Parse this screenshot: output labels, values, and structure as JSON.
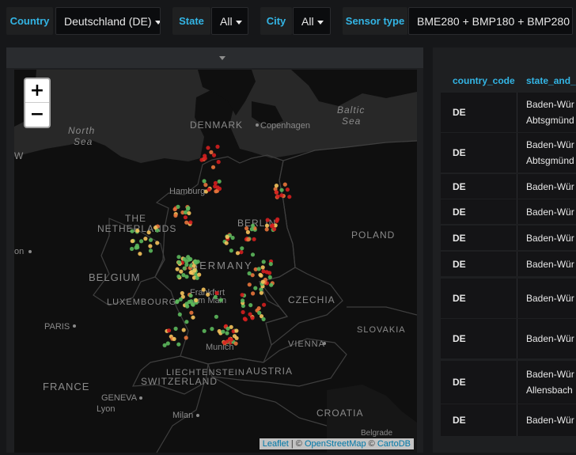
{
  "filters": [
    {
      "label": "Country",
      "value": "Deutschland (DE)"
    },
    {
      "label": "State",
      "value": "All"
    },
    {
      "label": "City",
      "value": "All"
    },
    {
      "label": "Sensor type",
      "value": "BME280 + BMP180 + BMP280"
    }
  ],
  "map": {
    "zoom_in": "+",
    "zoom_out": "−",
    "attribution": {
      "leaflet": "Leaflet",
      "sep1": " | © ",
      "osm": "OpenStreetMap",
      "sep2": " © ",
      "carto": "CartoDB"
    },
    "labels": {
      "denmark": "DENMARK",
      "copenhagen": "Copenhagen",
      "north_sea_1": "North",
      "north_sea_2": "Sea",
      "baltic_sea_1": "Baltic",
      "baltic_sea_2": "Sea",
      "hamburg": "Hamburg",
      "the": "THE",
      "netherlands": "NETHERLANDS",
      "berlin": "BERLIN",
      "poland": "POLAND",
      "germany": "GERMANY",
      "belgium": "BELGIUM",
      "luxembourg": "LUXEMBOURG",
      "frankfurt_1": "Frankfurt",
      "frankfurt_2": "am Main",
      "czechia": "CZECHIA",
      "paris": "PARIS",
      "slovakia": "SLOVAKIA",
      "vienna": "VIENNA",
      "munich": "Munich",
      "liechtenstein": "LIECHTENSTEIN",
      "austria": "AUSTRIA",
      "switzerland": "SWITZERLAND",
      "france": "FRANCE",
      "geneva": "GENEVA",
      "lyon": "Lyon",
      "milan": "Milan",
      "croatia": "CROATIA",
      "belgrade": "Belgrade",
      "on": "on",
      "w": "W"
    }
  },
  "table": {
    "columns": [
      "country_code",
      "state_and_"
    ],
    "rows": [
      {
        "country": "DE",
        "state": "Baden-Wür\nAbtsgmünd"
      },
      {
        "country": "DE",
        "state": "Baden-Wür\nAbtsgmünd"
      },
      {
        "country": "DE",
        "state": "Baden-Wür"
      },
      {
        "country": "DE",
        "state": "Baden-Wür"
      },
      {
        "country": "DE",
        "state": "Baden-Wür"
      },
      {
        "country": "DE",
        "state": "Baden-Wür"
      },
      {
        "country": "DE",
        "state": "Baden-Wür"
      },
      {
        "country": "DE",
        "state": "Baden-Wür"
      },
      {
        "country": "DE",
        "state": "Baden-Wür\nAllensbach"
      },
      {
        "country": "DE",
        "state": "Baden-Wür"
      }
    ]
  },
  "colors": {
    "accent": "#33b5e5",
    "marker_green": "#5cb85c",
    "marker_yellow": "#f5c35c",
    "marker_orange": "#e8743b",
    "marker_red": "#d41f1f"
  }
}
